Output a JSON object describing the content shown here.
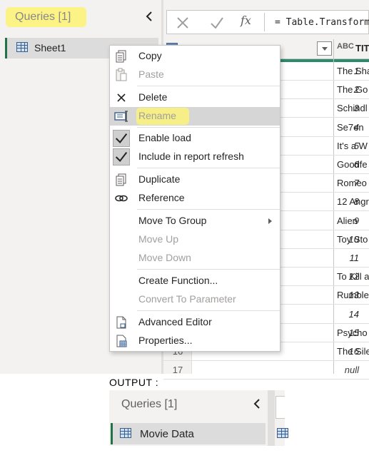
{
  "queries_pane": {
    "title": "Queries [1]",
    "items": [
      {
        "label": "Sheet1",
        "icon": "table-icon"
      }
    ]
  },
  "formula_bar": {
    "cancel_icon": "x-icon",
    "confirm_icon": "check-icon",
    "fx_label": "fx",
    "formula": "= Table.Transform"
  },
  "grid": {
    "index_header": "?",
    "title_header": "TIT",
    "title_type_icon": "ABC",
    "rows": [
      {
        "num": "",
        "index": "1",
        "title": "The Sha"
      },
      {
        "num": "",
        "index": "2",
        "title": "The Go"
      },
      {
        "num": "",
        "index": "3",
        "title": "Schindl"
      },
      {
        "num": "",
        "index": "4",
        "title": "Se7en"
      },
      {
        "num": "",
        "index": "5",
        "title": "It's a W"
      },
      {
        "num": "",
        "index": "6",
        "title": "Goodfe"
      },
      {
        "num": "",
        "index": "7",
        "title": "Romeo"
      },
      {
        "num": "",
        "index": "8",
        "title": "12 Angr"
      },
      {
        "num": "",
        "index": "9",
        "title": "Alien"
      },
      {
        "num": "",
        "index": "10",
        "title": "Toy Sto"
      },
      {
        "num": "",
        "index": "11",
        "title": ""
      },
      {
        "num": "",
        "index": "12",
        "title": "To Kill a"
      },
      {
        "num": "",
        "index": "13",
        "title": "Rumble"
      },
      {
        "num": "",
        "index": "14",
        "title": ""
      },
      {
        "num": "",
        "index": "15",
        "title": "Psycho"
      },
      {
        "num": "16",
        "index": "16",
        "title": "The Sile"
      },
      {
        "num": "17",
        "index": "null",
        "title": ""
      }
    ]
  },
  "context_menu": {
    "items": [
      {
        "label": "Copy",
        "icon": "copy-icon",
        "enabled": true
      },
      {
        "label": "Paste",
        "icon": "paste-icon",
        "enabled": false
      },
      {
        "label": "Delete",
        "icon": "delete-x-icon",
        "enabled": true
      },
      {
        "label": "Rename",
        "icon": "rename-icon",
        "enabled": false,
        "hovered": true
      },
      {
        "label": "Enable load",
        "icon": "checkmark-icon",
        "enabled": true,
        "checked": true
      },
      {
        "label": "Include in report refresh",
        "icon": "checkmark-icon",
        "enabled": true,
        "checked": true
      },
      {
        "label": "Duplicate",
        "icon": "duplicate-icon",
        "enabled": true
      },
      {
        "label": "Reference",
        "icon": "reference-link-icon",
        "enabled": true
      },
      {
        "label": "Move To Group",
        "icon": "",
        "enabled": true,
        "submenu": true
      },
      {
        "label": "Move Up",
        "icon": "",
        "enabled": false
      },
      {
        "label": "Move Down",
        "icon": "",
        "enabled": false
      },
      {
        "label": "Create Function...",
        "icon": "",
        "enabled": true
      },
      {
        "label": "Convert To Parameter",
        "icon": "",
        "enabled": false
      },
      {
        "label": "Advanced Editor",
        "icon": "advanced-editor-icon",
        "enabled": true
      },
      {
        "label": "Properties...",
        "icon": "properties-icon",
        "enabled": true
      }
    ]
  },
  "output": {
    "label": "OUTPUT :",
    "pane_title": "Queries [1]",
    "item_label": "Movie Data"
  },
  "colors": {
    "highlight": "#fcf37a",
    "accent_green": "#217346",
    "pane_bg": "#f3f2f1"
  }
}
